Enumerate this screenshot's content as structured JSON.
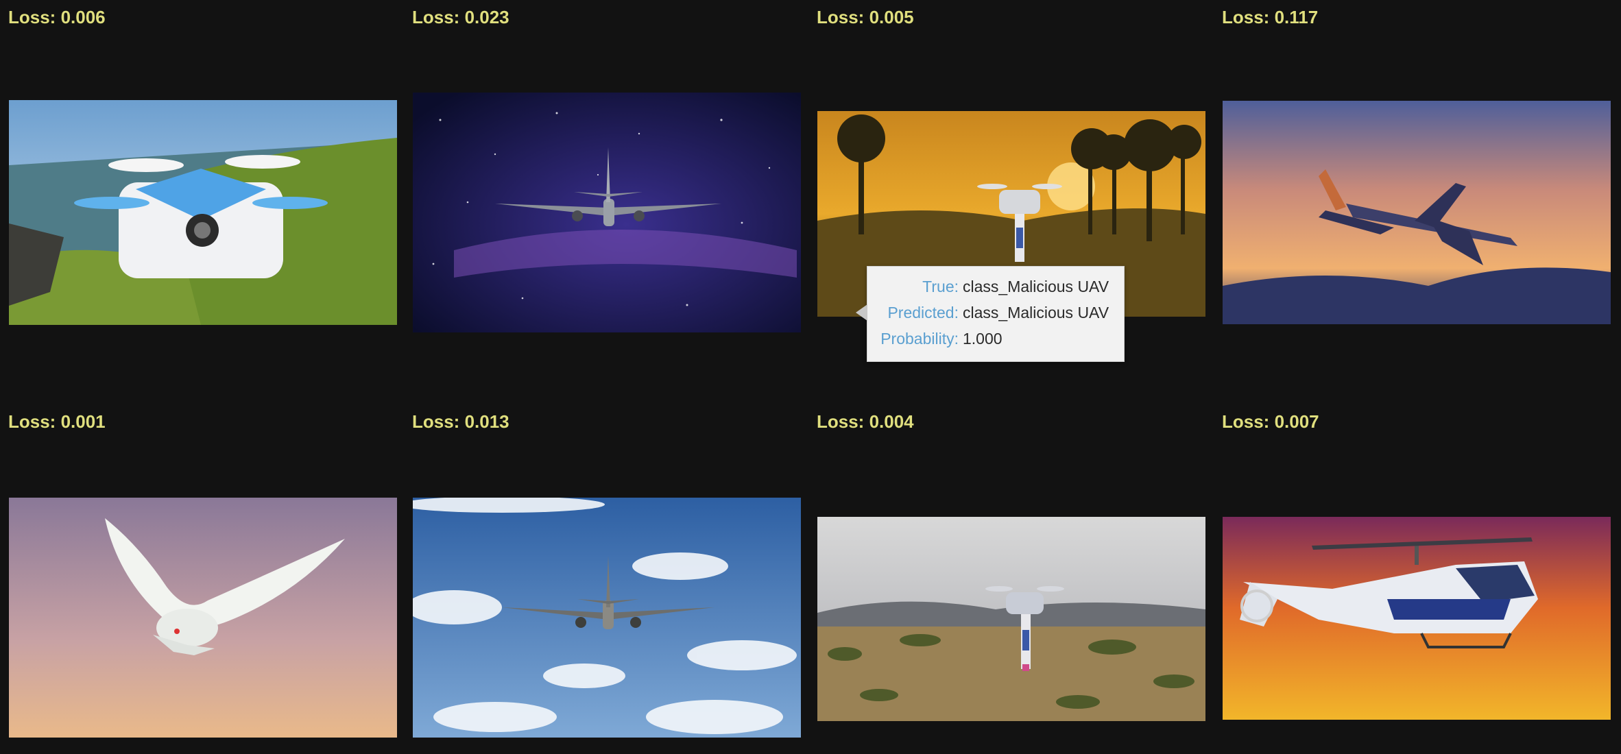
{
  "grid": [
    {
      "loss": "Loss: 0.006",
      "subject": "toy quadcopter drone on coastal cliff"
    },
    {
      "loss": "Loss: 0.023",
      "subject": "airliner against starry night sky"
    },
    {
      "loss": "Loss: 0.005",
      "subject": "drone carrying payload at sunset forest"
    },
    {
      "loss": "Loss: 0.117",
      "subject": "jet airliner at dusk"
    },
    {
      "loss": "Loss: 0.001",
      "subject": "white dove in flight"
    },
    {
      "loss": "Loss: 0.013",
      "subject": "airliner in blue cloudy sky"
    },
    {
      "loss": "Loss: 0.004",
      "subject": "drone with payload over desert scrub"
    },
    {
      "loss": "Loss: 0.007",
      "subject": "helicopter against orange sky"
    }
  ],
  "tooltip": {
    "true_label": "True:",
    "true_value": "class_Malicious UAV",
    "predicted_label": "Predicted:",
    "predicted_value": "class_Malicious UAV",
    "probability_label": "Probability:",
    "probability_value": "1.000"
  },
  "colors": {
    "background": "#121212",
    "loss_text": "#e0df7e",
    "tooltip_key": "#5a9fd0"
  }
}
